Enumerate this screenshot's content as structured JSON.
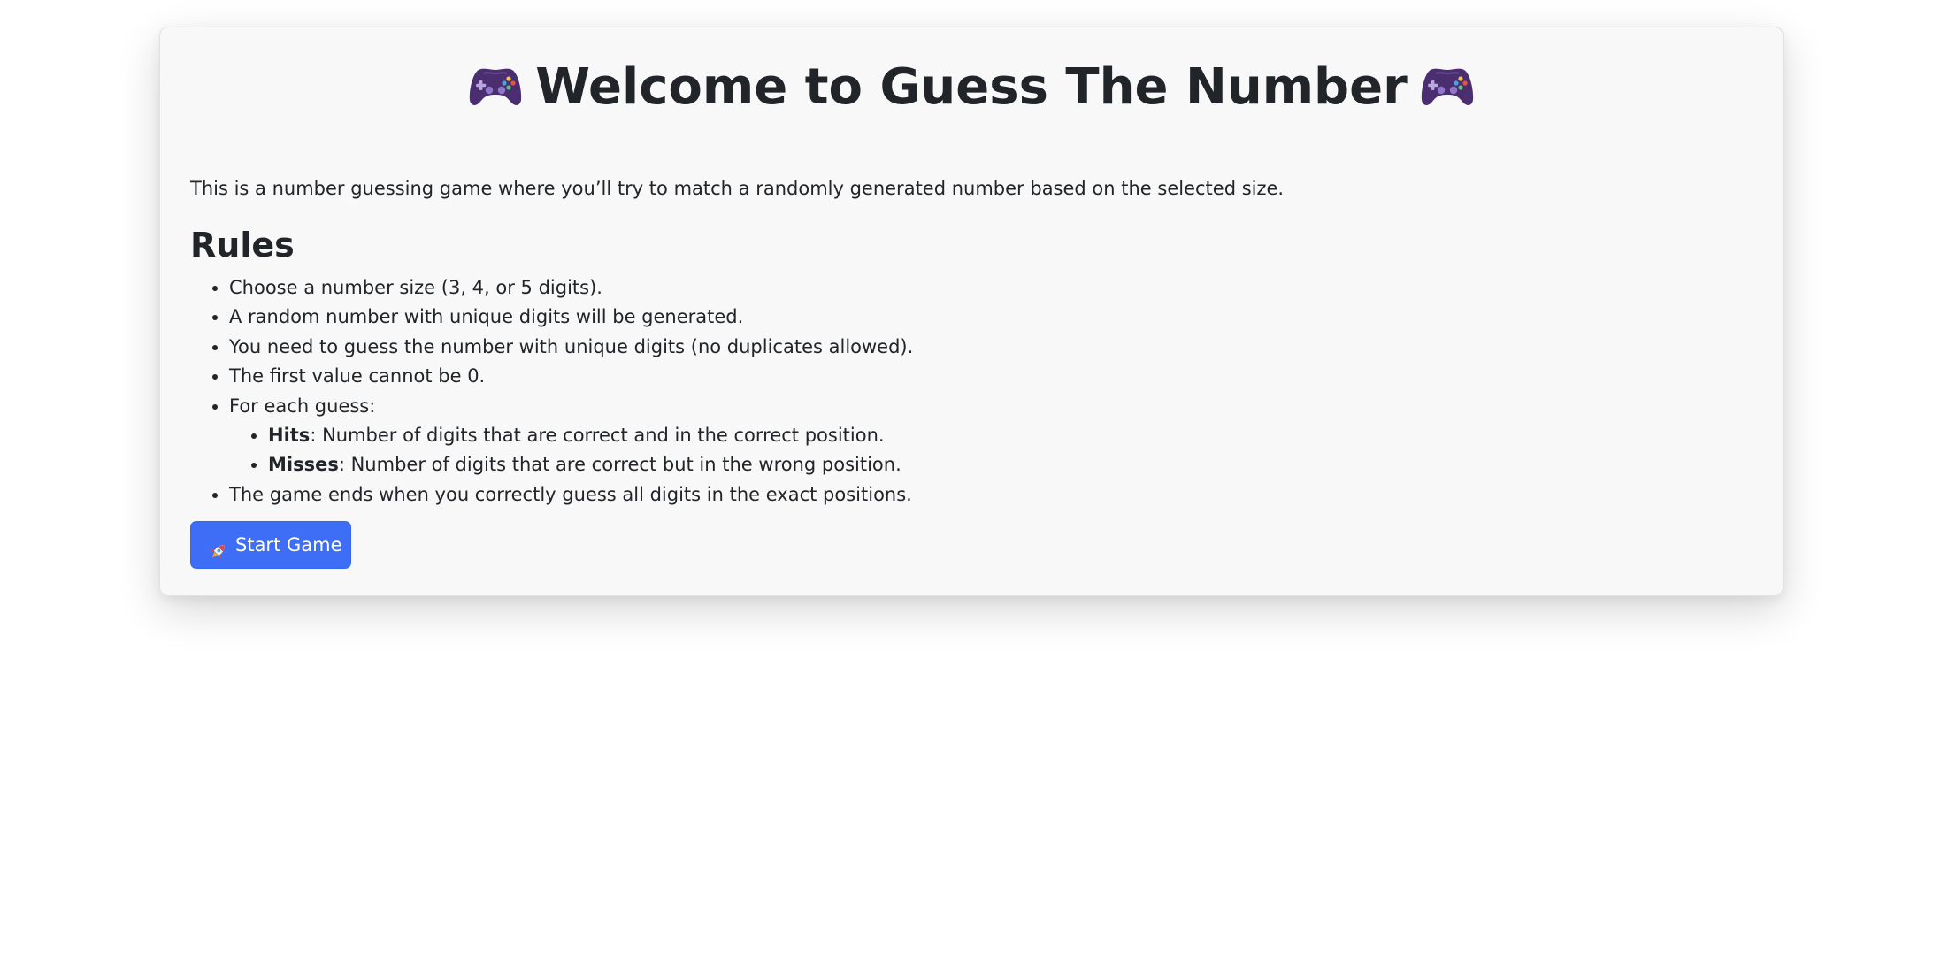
{
  "game": {
    "title": "Welcome to Guess The Number",
    "title_icons": [
      "game-controller-icon",
      "game-controller-icon"
    ],
    "intro": "This is a number guessing game where you’ll try to match a randomly generated number based on the selected size.",
    "rules_heading": "Rules",
    "rules": [
      "Choose a number size (3, 4, or 5 digits).",
      "A random number with unique digits will be generated.",
      "You need to guess the number with unique digits (no duplicates allowed).",
      "The first value cannot be 0.",
      "For each guess:"
    ],
    "sub_rules": [
      {
        "term": "Hits",
        "text": ": Number of digits that are correct and in the correct position."
      },
      {
        "term": "Misses",
        "text": ": Number of digits that are correct but in the wrong position."
      }
    ],
    "final_rule": "The game ends when you correctly guess all digits in the exact positions.",
    "start_button": {
      "icon": "rocket-icon",
      "label": "Start Game"
    }
  },
  "colors": {
    "card_background": "#f8f8f8",
    "button_primary": "#3d6ef5",
    "controller": "#4b2e6f",
    "text": "#212529"
  }
}
